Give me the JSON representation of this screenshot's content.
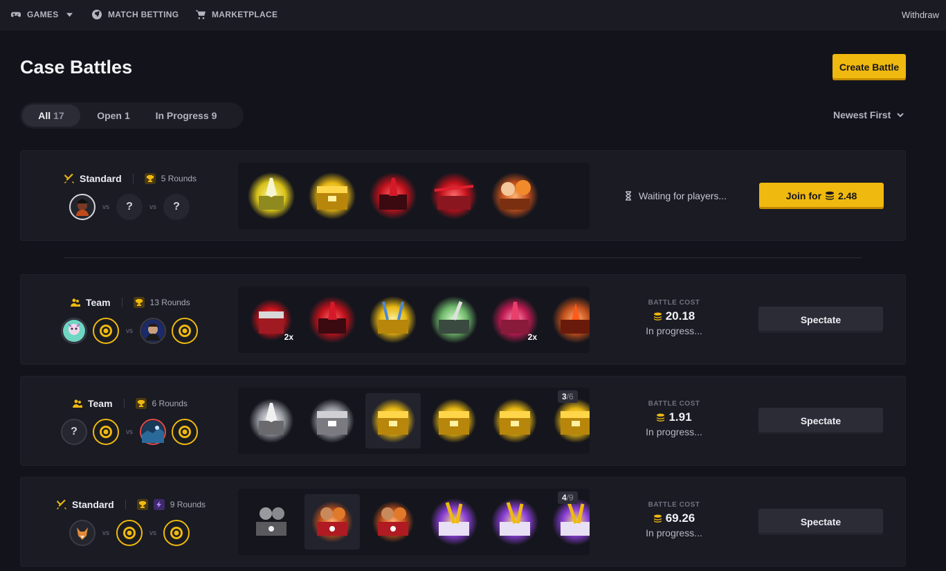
{
  "nav": {
    "games": "GAMES",
    "match_betting": "MATCH BETTING",
    "marketplace": "MARKETPLACE",
    "withdraw": "Withdraw"
  },
  "header": {
    "title": "Case Battles",
    "create_button": "Create Battle"
  },
  "filters": {
    "all_label": "All",
    "all_count": "17",
    "open_label": "Open",
    "open_count": "1",
    "progress_label": "In Progress",
    "progress_count": "9",
    "sort": "Newest First"
  },
  "colors": {
    "accent": "#f0b90f",
    "background": "#13141b",
    "card": "#1a1b23"
  },
  "battles": [
    {
      "mode": "Standard",
      "rounds": "5 Rounds",
      "status": "Waiting for players...",
      "join_label": "Join for",
      "join_cost": "2.48",
      "vs": "vs",
      "empty_slot": "?",
      "cases": [
        "angel-yellow-case",
        "gold-case",
        "red-crystal-case",
        "red-rifle-case",
        "tiger-case"
      ]
    },
    {
      "mode": "Team",
      "rounds": "13 Rounds",
      "cost_label": "BATTLE COST",
      "cost": "20.18",
      "progress": "In progress...",
      "action": "Spectate",
      "vs": "vs",
      "multipliers": [
        "2x",
        "2x"
      ],
      "cases": [
        "red-box-case",
        "red-crystal-case",
        "gold-sword-case",
        "green-glow-case",
        "pink-crystal-case",
        "red-fire-case"
      ]
    },
    {
      "mode": "Team",
      "rounds": "6 Rounds",
      "cost_label": "BATTLE COST",
      "cost": "1.91",
      "progress": "In progress...",
      "action": "Spectate",
      "vs": "vs",
      "empty_slot": "?",
      "round_current": "3",
      "round_total": "6",
      "cases": [
        "silver-angel-case",
        "silver-case",
        "gold-case",
        "gold-case",
        "gold-case",
        "gold-case"
      ]
    },
    {
      "mode": "Standard",
      "rounds": "9 Rounds",
      "cost_label": "BATTLE COST",
      "cost": "69.26",
      "progress": "In progress...",
      "action": "Spectate",
      "vs": "vs",
      "round_current": "4",
      "round_total": "9",
      "cases": [
        "grey-soldier-case",
        "red-soldier-case",
        "red-soldier-case",
        "purple-gold-case",
        "purple-gold-case",
        "purple-gold-case"
      ]
    }
  ]
}
